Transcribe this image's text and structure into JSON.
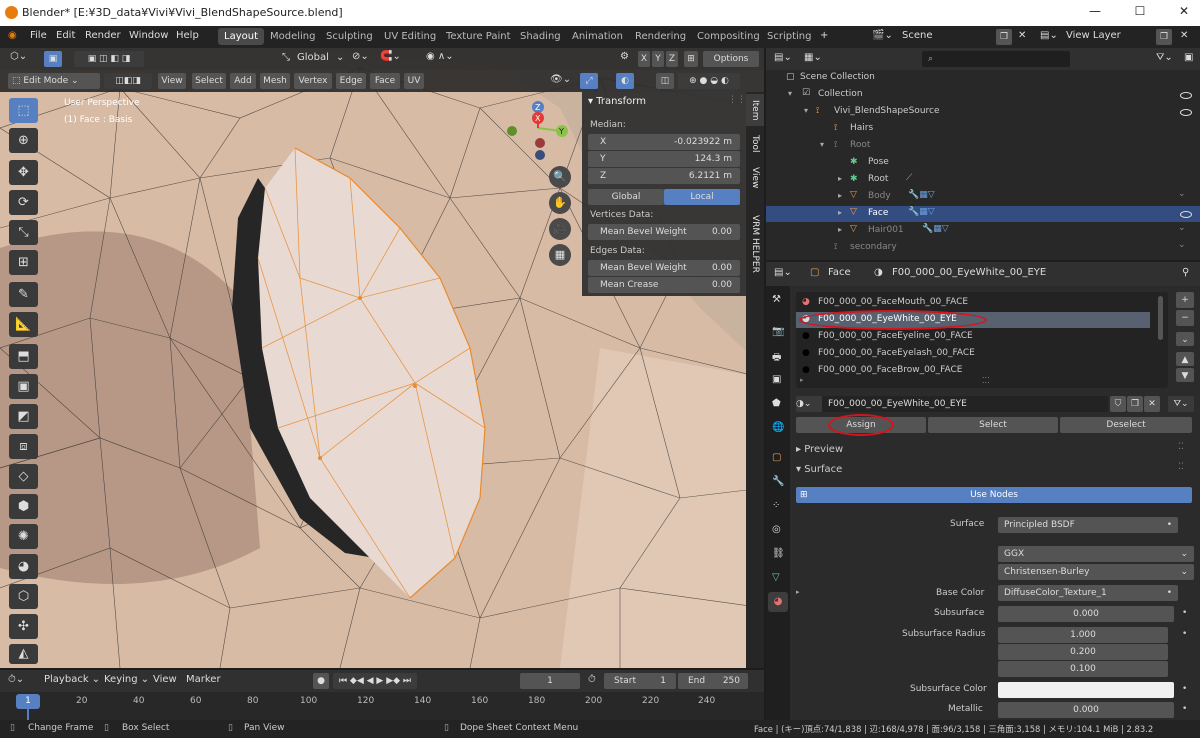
{
  "window": {
    "title": "Blender* [E:¥3D_data¥Vivi¥Vivi_BlendShapeSource.blend]",
    "minimize": "—",
    "maximize": "☐",
    "close": "✕"
  },
  "menu": {
    "items": [
      "File",
      "Edit",
      "Render",
      "Window",
      "Help"
    ],
    "workspaces": [
      "Layout",
      "Modeling",
      "Sculpting",
      "UV Editing",
      "Texture Paint",
      "Shading",
      "Animation",
      "Rendering",
      "Compositing",
      "Scripting"
    ],
    "add_tab": "+",
    "scene": "Scene",
    "view_layer": "View Layer"
  },
  "viewport": {
    "transform_orientation": "Global",
    "options": "Options",
    "axes": [
      "X",
      "Y",
      "Z"
    ],
    "mode": "Edit Mode",
    "header_menus": [
      "View",
      "Select",
      "Add",
      "Mesh",
      "Vertex",
      "Edge",
      "Face",
      "UV"
    ],
    "overlay_title": "User Perspective",
    "overlay_sub": "(1) Face : Basis",
    "gizmo": {
      "x": "X",
      "y": "Y",
      "z": "Z"
    }
  },
  "npanel": {
    "title": "Transform",
    "median": "Median:",
    "x_label": "X",
    "x_val": "-0.023922 m",
    "y_label": "Y",
    "y_val": "124.3 m",
    "z_label": "Z",
    "z_val": "6.2121 m",
    "global": "Global",
    "local": "Local",
    "vertices_data": "Vertices Data:",
    "mean_bevel_weight": "Mean Bevel Weight",
    "vbw_val": "0.00",
    "edges_data": "Edges Data:",
    "ebw_val": "0.00",
    "mean_crease": "Mean Crease",
    "crease_val": "0.00",
    "tabs": [
      "Item",
      "Tool",
      "View",
      "VRM HELPER"
    ]
  },
  "outliner": {
    "search_placeholder": "",
    "items": [
      {
        "label": "Scene Collection"
      },
      {
        "label": "Collection"
      },
      {
        "label": "Vivi_BlendShapeSource"
      },
      {
        "label": "Hairs"
      },
      {
        "label": "Root"
      },
      {
        "label": "Pose"
      },
      {
        "label": "Root"
      },
      {
        "label": "Body"
      },
      {
        "label": "Face"
      },
      {
        "label": "Hair001"
      },
      {
        "label": "secondary"
      }
    ]
  },
  "properties": {
    "object": "Face",
    "material": "F00_000_00_EyeWhite_00_EYE",
    "slots": [
      "F00_000_00_FaceMouth_00_FACE",
      "F00_000_00_EyeWhite_00_EYE",
      "F00_000_00_FaceEyeline_00_FACE",
      "F00_000_00_FaceEyelash_00_FACE",
      "F00_000_00_FaceBrow_00_FACE"
    ],
    "material_name": "F00_000_00_EyeWhite_00_EYE",
    "assign": "Assign",
    "select": "Select",
    "deselect": "Deselect",
    "preview": "Preview",
    "surface_section": "Surface",
    "use_nodes": "Use Nodes",
    "surface_label": "Surface",
    "surface_val": "Principled BSDF",
    "ggx": "GGX",
    "christensen": "Christensen-Burley",
    "base_color_label": "Base Color",
    "base_color_val": "DiffuseColor_Texture_1",
    "subsurface_label": "Subsurface",
    "subsurface_val": "0.000",
    "radius_label": "Subsurface Radius",
    "radius_vals": [
      "1.000",
      "0.200",
      "0.100"
    ],
    "ss_color_label": "Subsurface Color",
    "metallic_label": "Metallic",
    "metallic_val": "0.000"
  },
  "timeline": {
    "menus": [
      "Playback",
      "Keying",
      "View",
      "Marker"
    ],
    "current_frame": "1",
    "start_label": "Start",
    "start_val": "1",
    "end_label": "End",
    "end_val": "250",
    "frame_badge": "1",
    "ticks": [
      "20",
      "40",
      "60",
      "80",
      "100",
      "120",
      "140",
      "160",
      "180",
      "200",
      "220",
      "240"
    ]
  },
  "statusbar": {
    "change_frame": "Change Frame",
    "box_select": "Box Select",
    "pan_view": "Pan View",
    "context_menu": "Dope Sheet Context Menu",
    "stats": "Face | (キー)頂点:74/1,838 | 辺:168/4,978 | 面:96/3,158 | 三角面:3,158 | メモリ:104.1 MiB | 2.83.2"
  },
  "colors": {
    "accent": "#5680c2",
    "selection": "#334d80",
    "annotation": "#d7131b",
    "mesh_edge": "#e88a2e"
  }
}
